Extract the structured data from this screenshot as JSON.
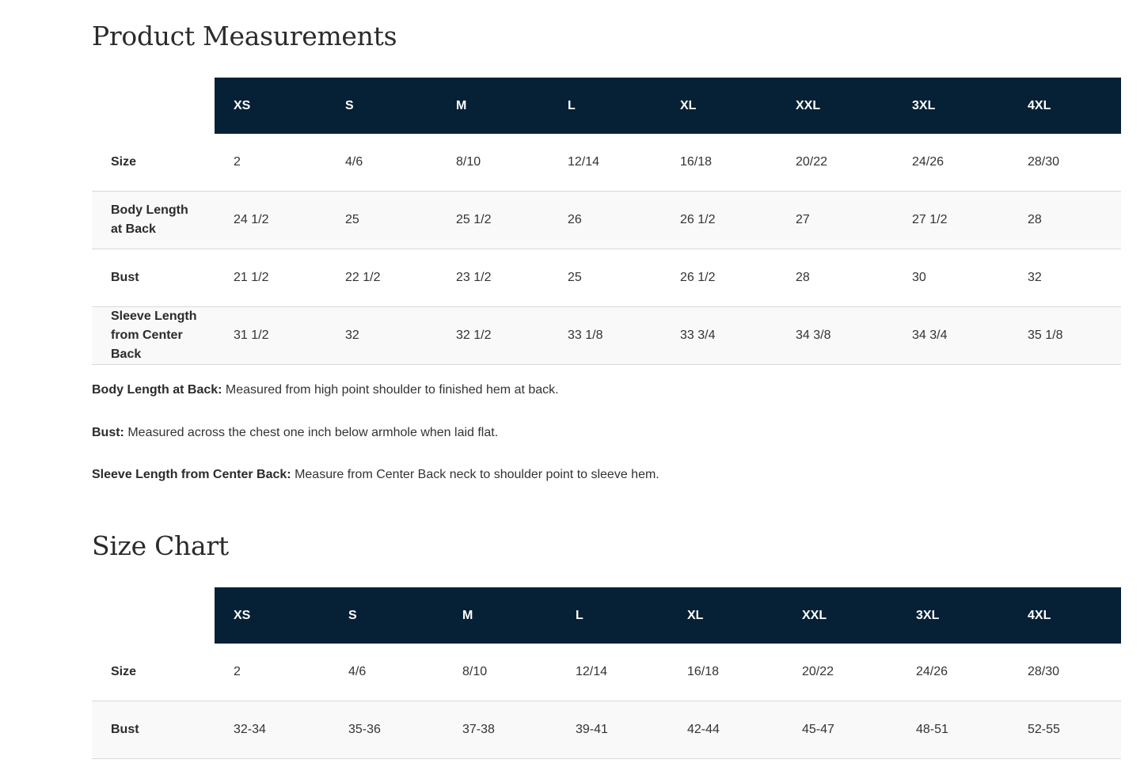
{
  "measurements": {
    "title": "Product Measurements",
    "columns": [
      "XS",
      "S",
      "M",
      "L",
      "XL",
      "XXL",
      "3XL",
      "4XL"
    ],
    "rows": [
      {
        "label": "Size",
        "values": [
          "2",
          "4/6",
          "8/10",
          "12/14",
          "16/18",
          "20/22",
          "24/26",
          "28/30"
        ]
      },
      {
        "label": "Body Length at Back",
        "values": [
          "24 1/2",
          "25",
          "25 1/2",
          "26",
          "26 1/2",
          "27",
          "27 1/2",
          "28"
        ]
      },
      {
        "label": "Bust",
        "values": [
          "21 1/2",
          "22 1/2",
          "23 1/2",
          "25",
          "26 1/2",
          "28",
          "30",
          "32"
        ]
      },
      {
        "label": "Sleeve Length from Center Back",
        "values": [
          "31 1/2",
          "32",
          "32 1/2",
          "33 1/8",
          "33 3/4",
          "34 3/8",
          "34 3/4",
          "35 1/8"
        ]
      }
    ],
    "notes": [
      {
        "term": "Body Length at Back:",
        "text": " Measured from high point shoulder to finished hem at back."
      },
      {
        "term": "Bust:",
        "text": " Measured across the chest one inch below armhole when laid flat."
      },
      {
        "term": "Sleeve Length from Center Back:",
        "text": " Measure from Center Back neck to shoulder point to sleeve hem."
      }
    ]
  },
  "size_chart": {
    "title": "Size Chart",
    "columns": [
      "XS",
      "S",
      "M",
      "L",
      "XL",
      "XXL",
      "3XL",
      "4XL"
    ],
    "rows": [
      {
        "label": "Size",
        "values": [
          "2",
          "4/6",
          "8/10",
          "12/14",
          "16/18",
          "20/22",
          "24/26",
          "28/30"
        ]
      },
      {
        "label": "Bust",
        "values": [
          "32-34",
          "35-36",
          "37-38",
          "39-41",
          "42-44",
          "45-47",
          "48-51",
          "52-55"
        ]
      }
    ]
  },
  "colors": {
    "header_bg": "#062136",
    "header_text": "#ffffff",
    "row_divider": "#d9d9d9"
  }
}
